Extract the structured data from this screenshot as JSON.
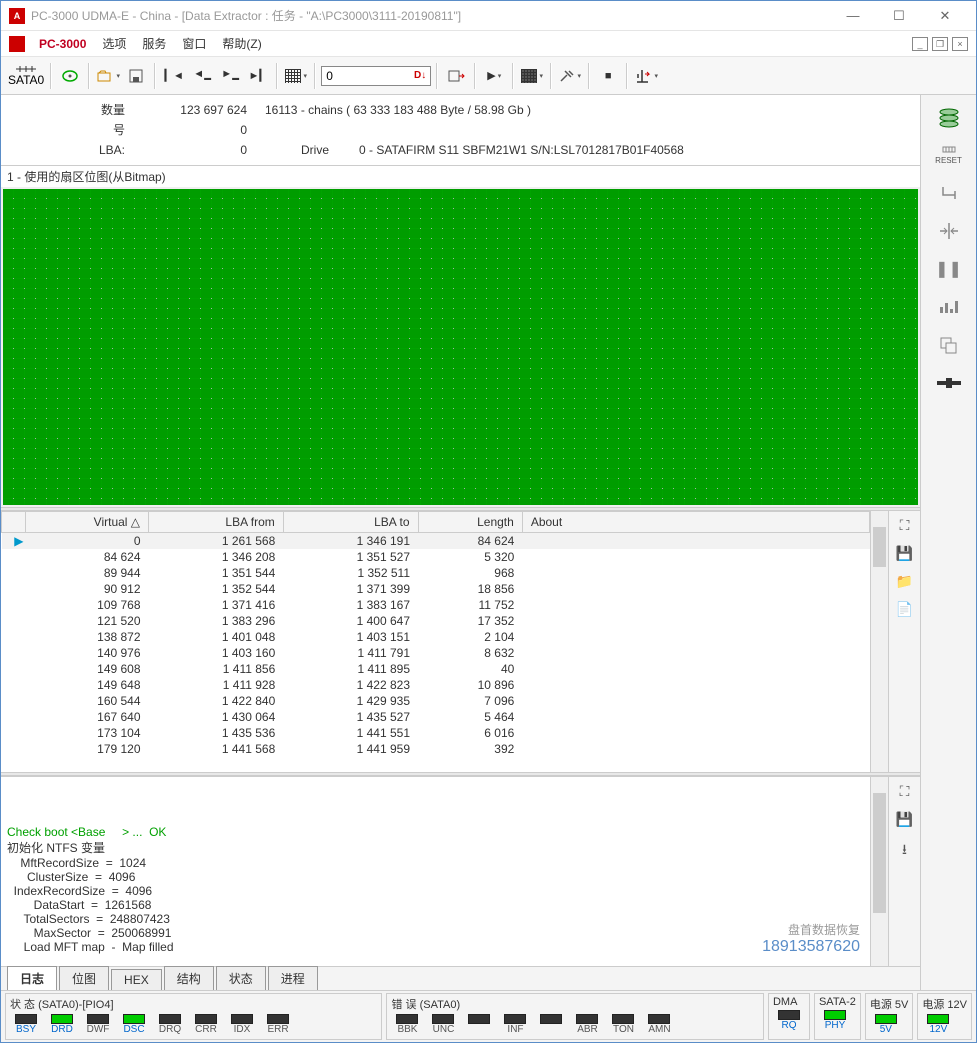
{
  "window": {
    "title": "PC-3000 UDMA-E - China - [Data Extractor : 任务 - \"A:\\PC3000\\3111-20190811\"]"
  },
  "menu": {
    "brand": "PC-3000",
    "items": [
      "选项",
      "服务",
      "窗口",
      "帮助(Z)"
    ]
  },
  "toolbar": {
    "sata_label": "SATA0",
    "num_value": "0",
    "num_marker": "D↓"
  },
  "info": {
    "rows": [
      {
        "k": "数量",
        "v": "123 697 624",
        "extra": "16113 - chains   ( 63 333 183 488 Byte /   58.98 Gb )"
      },
      {
        "k": "号",
        "v": "0",
        "extra": ""
      },
      {
        "k": "LBA:",
        "v": "0",
        "extra_lbl": "Drive",
        "extra": "0 - SATAFIRM   S11 SBFM21W1 S/N:LSL7012817B01F40568"
      }
    ]
  },
  "map": {
    "label": "1 - 使用的扇区位图(从Bitmap)"
  },
  "table": {
    "headers": [
      "Virtual △",
      "LBA from",
      "LBA to",
      "Length",
      "About"
    ],
    "rows": [
      {
        "v": "0",
        "f": "1 261 568",
        "t": "1 346 191",
        "l": "84 624",
        "sel": true
      },
      {
        "v": "84 624",
        "f": "1 346 208",
        "t": "1 351 527",
        "l": "5 320"
      },
      {
        "v": "89 944",
        "f": "1 351 544",
        "t": "1 352 511",
        "l": "968"
      },
      {
        "v": "90 912",
        "f": "1 352 544",
        "t": "1 371 399",
        "l": "18 856"
      },
      {
        "v": "109 768",
        "f": "1 371 416",
        "t": "1 383 167",
        "l": "11 752"
      },
      {
        "v": "121 520",
        "f": "1 383 296",
        "t": "1 400 647",
        "l": "17 352"
      },
      {
        "v": "138 872",
        "f": "1 401 048",
        "t": "1 403 151",
        "l": "2 104"
      },
      {
        "v": "140 976",
        "f": "1 403 160",
        "t": "1 411 791",
        "l": "8 632"
      },
      {
        "v": "149 608",
        "f": "1 411 856",
        "t": "1 411 895",
        "l": "40"
      },
      {
        "v": "149 648",
        "f": "1 411 928",
        "t": "1 422 823",
        "l": "10 896"
      },
      {
        "v": "160 544",
        "f": "1 422 840",
        "t": "1 429 935",
        "l": "7 096"
      },
      {
        "v": "167 640",
        "f": "1 430 064",
        "t": "1 435 527",
        "l": "5 464"
      },
      {
        "v": "173 104",
        "f": "1 435 536",
        "t": "1 441 551",
        "l": "6 016"
      },
      {
        "v": "179 120",
        "f": "1 441 568",
        "t": "1 441 959",
        "l": "392"
      }
    ]
  },
  "log": {
    "lines": [
      {
        "text": "Check boot <Base     > ...  OK",
        "cls": "green"
      },
      {
        "text": "初始化 NTFS 变量"
      },
      {
        "text": "    MftRecordSize  =  1024"
      },
      {
        "text": "      ClusterSize  =  4096"
      },
      {
        "text": "  IndexRecordSize  =  4096"
      },
      {
        "text": "        DataStart  =  1261568"
      },
      {
        "text": "     TotalSectors  =  248807423"
      },
      {
        "text": "        MaxSector  =  250068991"
      },
      {
        "text": "     Load MFT map  -  Map filled"
      }
    ],
    "watermark": {
      "t1": "盘首数据恢复",
      "t2": "18913587620"
    }
  },
  "tabs": {
    "items": [
      {
        "label": "日志",
        "active": true
      },
      {
        "label": "位图"
      },
      {
        "label": "HEX"
      },
      {
        "label": "结构"
      },
      {
        "label": "状态"
      },
      {
        "label": "进程"
      }
    ]
  },
  "status": {
    "g1": {
      "label": "状 态 (SATA0)-[PIO4]",
      "leds": [
        {
          "t": "BSY",
          "on": false,
          "blue": true
        },
        {
          "t": "DRD",
          "on": true,
          "blue": true
        },
        {
          "t": "DWF",
          "on": false
        },
        {
          "t": "DSC",
          "on": true,
          "blue": true
        },
        {
          "t": "DRQ",
          "on": false
        },
        {
          "t": "CRR",
          "on": false
        },
        {
          "t": "IDX",
          "on": false
        },
        {
          "t": "ERR",
          "on": false
        }
      ]
    },
    "g2": {
      "label": "错 误 (SATA0)",
      "leds": [
        {
          "t": "BBK",
          "on": false
        },
        {
          "t": "UNC",
          "on": false
        },
        {
          "t": "",
          "on": false
        },
        {
          "t": "INF",
          "on": false
        },
        {
          "t": "",
          "on": false
        },
        {
          "t": "ABR",
          "on": false
        },
        {
          "t": "TON",
          "on": false
        },
        {
          "t": "AMN",
          "on": false
        }
      ]
    },
    "g3": {
      "label": "DMA",
      "leds": [
        {
          "t": "RQ",
          "on": false,
          "blue": true
        }
      ]
    },
    "g4": {
      "label": "SATA-2",
      "leds": [
        {
          "t": "PHY",
          "on": true,
          "blue": true
        }
      ]
    },
    "g5": {
      "label": "电源 5V",
      "leds": [
        {
          "t": "5V",
          "on": true,
          "blue": true
        }
      ]
    },
    "g6": {
      "label": "电源 12V",
      "leds": [
        {
          "t": "12V",
          "on": true,
          "blue": true
        }
      ]
    }
  },
  "icons": {
    "min": "—",
    "max": "☐",
    "close": "✕"
  }
}
